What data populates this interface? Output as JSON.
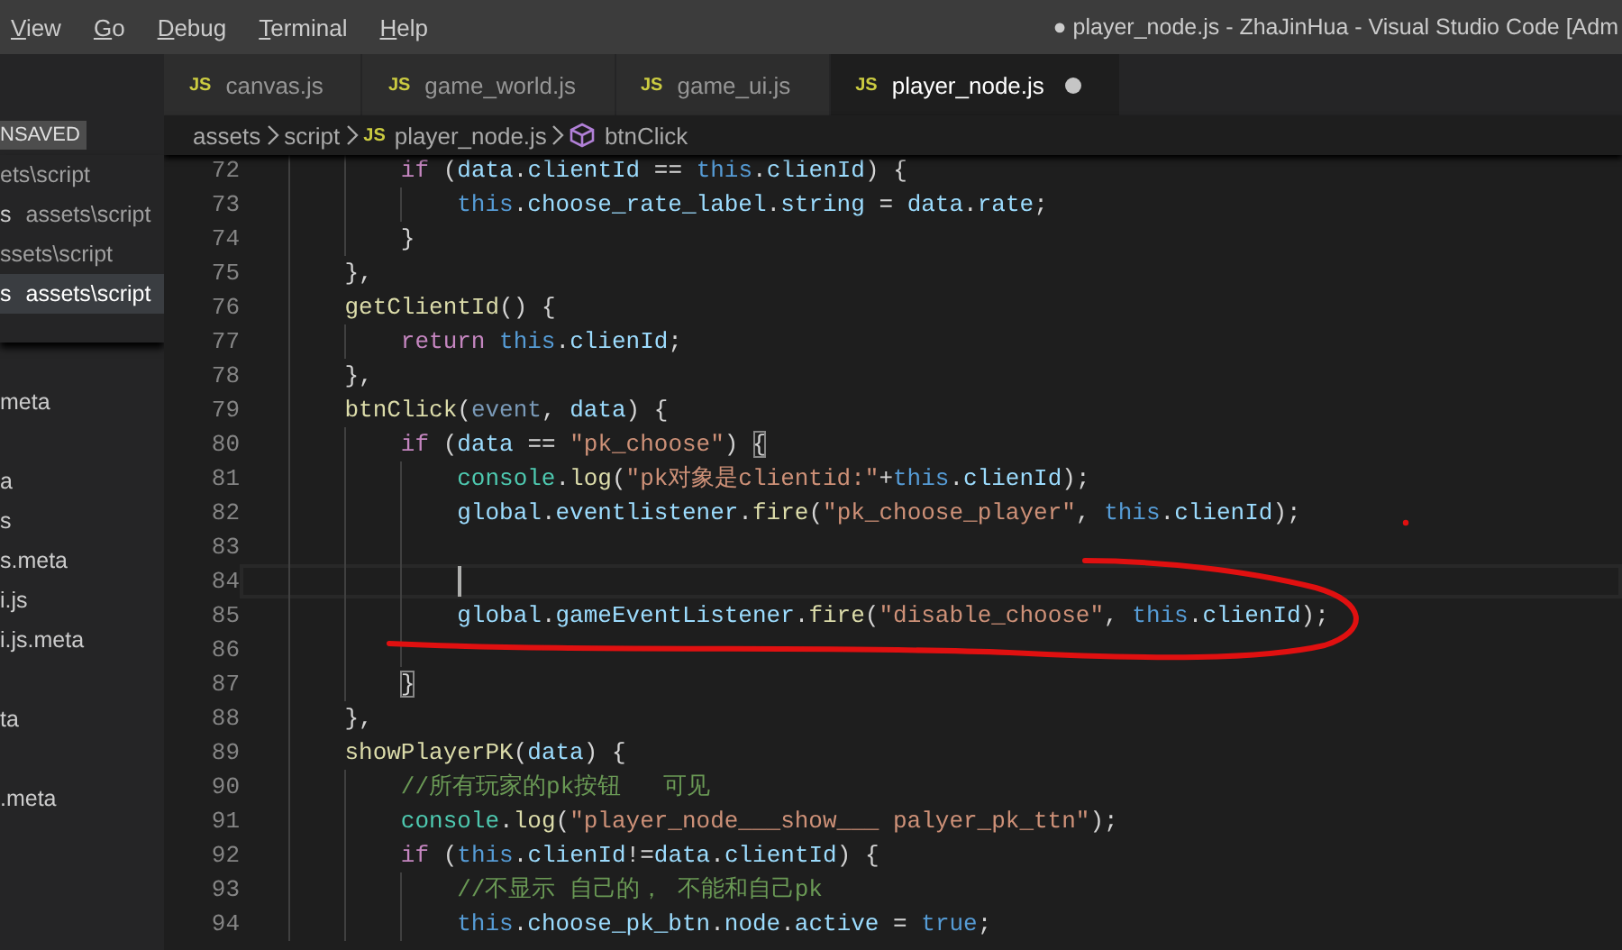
{
  "menu": {
    "items": [
      {
        "label": "View"
      },
      {
        "label": "Go"
      },
      {
        "label": "Debug"
      },
      {
        "label": "Terminal"
      },
      {
        "label": "Help"
      }
    ]
  },
  "window": {
    "title": "● player_node.js - ZhaJinHua - Visual Studio Code [Adm"
  },
  "sidebar": {
    "badge": "NSAVED",
    "open_editors": [
      {
        "path": "ets\\script",
        "selected": false
      },
      {
        "name": "s",
        "path": "assets\\script",
        "selected": false
      },
      {
        "path": "ssets\\script",
        "selected": false
      },
      {
        "name": "s",
        "path": "assets\\script",
        "selected": true
      }
    ],
    "explorer": [
      {
        "kind": "blank"
      },
      {
        "kind": "file",
        "label": "meta"
      },
      {
        "kind": "blank"
      },
      {
        "kind": "file",
        "label": "a"
      },
      {
        "kind": "file",
        "label": "s"
      },
      {
        "kind": "file",
        "label": "s.meta"
      },
      {
        "kind": "file",
        "label": "i.js"
      },
      {
        "kind": "file",
        "label": "i.js.meta"
      },
      {
        "kind": "blank"
      },
      {
        "kind": "file",
        "label": "ta"
      },
      {
        "kind": "blank"
      },
      {
        "kind": "file",
        "label": ".meta"
      }
    ]
  },
  "tabs": [
    {
      "icon_text": "JS",
      "label": "canvas.js",
      "selected": false,
      "dirty": false
    },
    {
      "icon_text": "JS",
      "label": "game_world.js",
      "selected": false,
      "dirty": false
    },
    {
      "icon_text": "JS",
      "label": "game_ui.js",
      "selected": false,
      "dirty": false
    },
    {
      "icon_text": "JS",
      "label": "player_node.js",
      "selected": true,
      "dirty": true
    }
  ],
  "breadcrumb": [
    {
      "kind": "folder",
      "text": "assets"
    },
    {
      "kind": "folder",
      "text": "script"
    },
    {
      "kind": "file",
      "icon_text": "JS",
      "text": "player_node.js"
    },
    {
      "kind": "symbol",
      "text": "btnClick"
    }
  ],
  "editor": {
    "lines": [
      {
        "number": "72",
        "current": false,
        "tokens": [
          {
            "kind": "kw",
            "text": "        if"
          },
          {
            "kind": "plain",
            "text": " ("
          },
          {
            "kind": "var",
            "text": "data"
          },
          {
            "kind": "plain",
            "text": "."
          },
          {
            "kind": "var",
            "text": "clientId"
          },
          {
            "kind": "plain",
            "text": " == "
          },
          {
            "kind": "this",
            "text": "this"
          },
          {
            "kind": "plain",
            "text": "."
          },
          {
            "kind": "var",
            "text": "clienId"
          },
          {
            "kind": "plain",
            "text": ") {"
          }
        ]
      },
      {
        "number": "73",
        "current": false,
        "tokens": [
          {
            "kind": "this",
            "text": "            this"
          },
          {
            "kind": "plain",
            "text": "."
          },
          {
            "kind": "var",
            "text": "choose_rate_label"
          },
          {
            "kind": "plain",
            "text": "."
          },
          {
            "kind": "var",
            "text": "string"
          },
          {
            "kind": "plain",
            "text": " = "
          },
          {
            "kind": "var",
            "text": "data"
          },
          {
            "kind": "plain",
            "text": "."
          },
          {
            "kind": "var",
            "text": "rate"
          },
          {
            "kind": "plain",
            "text": ";"
          }
        ]
      },
      {
        "number": "74",
        "current": false,
        "tokens": [
          {
            "kind": "plain",
            "text": "        }"
          }
        ]
      },
      {
        "number": "75",
        "current": false,
        "tokens": [
          {
            "kind": "plain",
            "text": "    },"
          }
        ]
      },
      {
        "number": "76",
        "current": false,
        "tokens": [
          {
            "kind": "fn",
            "text": "    getClientId"
          },
          {
            "kind": "plain",
            "text": "() {"
          }
        ]
      },
      {
        "number": "77",
        "current": false,
        "tokens": [
          {
            "kind": "kw",
            "text": "        return "
          },
          {
            "kind": "this",
            "text": "this"
          },
          {
            "kind": "plain",
            "text": "."
          },
          {
            "kind": "var",
            "text": "clienId"
          },
          {
            "kind": "plain",
            "text": ";"
          }
        ]
      },
      {
        "number": "78",
        "current": false,
        "tokens": [
          {
            "kind": "plain",
            "text": "    },"
          }
        ]
      },
      {
        "number": "79",
        "current": false,
        "tokens": [
          {
            "kind": "fn",
            "text": "    btnClick"
          },
          {
            "kind": "plain",
            "text": "("
          },
          {
            "kind": "unused",
            "text": "event"
          },
          {
            "kind": "plain",
            "text": ", "
          },
          {
            "kind": "var",
            "text": "data"
          },
          {
            "kind": "plain",
            "text": ") {"
          }
        ]
      },
      {
        "number": "80",
        "current": false,
        "tokens": [
          {
            "kind": "kw",
            "text": "        if"
          },
          {
            "kind": "plain",
            "text": " ("
          },
          {
            "kind": "var",
            "text": "data"
          },
          {
            "kind": "plain",
            "text": " == "
          },
          {
            "kind": "str",
            "text": "\"pk_choose\""
          },
          {
            "kind": "plain",
            "text": ") "
          },
          {
            "kind": "match",
            "text": "{"
          }
        ]
      },
      {
        "number": "81",
        "current": false,
        "tokens": [
          {
            "kind": "console",
            "text": "            console"
          },
          {
            "kind": "plain",
            "text": "."
          },
          {
            "kind": "fn",
            "text": "log"
          },
          {
            "kind": "plain",
            "text": "("
          },
          {
            "kind": "str",
            "text": "\"pk对象是clientid:\""
          },
          {
            "kind": "plain",
            "text": "+"
          },
          {
            "kind": "this",
            "text": "this"
          },
          {
            "kind": "plain",
            "text": "."
          },
          {
            "kind": "var",
            "text": "clienId"
          },
          {
            "kind": "plain",
            "text": ");"
          }
        ]
      },
      {
        "number": "82",
        "current": false,
        "tokens": [
          {
            "kind": "var",
            "text": "            global"
          },
          {
            "kind": "plain",
            "text": "."
          },
          {
            "kind": "var",
            "text": "eventlistener"
          },
          {
            "kind": "plain",
            "text": "."
          },
          {
            "kind": "fn",
            "text": "fire"
          },
          {
            "kind": "plain",
            "text": "("
          },
          {
            "kind": "str",
            "text": "\"pk_choose_player\""
          },
          {
            "kind": "plain",
            "text": ", "
          },
          {
            "kind": "this",
            "text": "this"
          },
          {
            "kind": "plain",
            "text": "."
          },
          {
            "kind": "var",
            "text": "clienId"
          },
          {
            "kind": "plain",
            "text": ");"
          }
        ]
      },
      {
        "number": "83",
        "current": false
      },
      {
        "number": "84",
        "current": true
      },
      {
        "number": "85",
        "current": false,
        "tokens": [
          {
            "kind": "var",
            "text": "            global"
          },
          {
            "kind": "plain",
            "text": "."
          },
          {
            "kind": "var",
            "text": "gameEventListener"
          },
          {
            "kind": "plain",
            "text": "."
          },
          {
            "kind": "fn",
            "text": "fire"
          },
          {
            "kind": "plain",
            "text": "("
          },
          {
            "kind": "str",
            "text": "\"disable_choose\""
          },
          {
            "kind": "plain",
            "text": ", "
          },
          {
            "kind": "this",
            "text": "this"
          },
          {
            "kind": "plain",
            "text": "."
          },
          {
            "kind": "var",
            "text": "clienId"
          },
          {
            "kind": "plain",
            "text": ");"
          }
        ]
      },
      {
        "number": "86",
        "current": false
      },
      {
        "number": "87",
        "current": false,
        "tokens": [
          {
            "kind": "match",
            "text": "        }"
          }
        ]
      },
      {
        "number": "88",
        "current": false,
        "tokens": [
          {
            "kind": "plain",
            "text": "    },"
          }
        ]
      },
      {
        "number": "89",
        "current": false,
        "tokens": [
          {
            "kind": "fn",
            "text": "    showPlayerPK"
          },
          {
            "kind": "plain",
            "text": "("
          },
          {
            "kind": "var",
            "text": "data"
          },
          {
            "kind": "plain",
            "text": ") {"
          }
        ]
      },
      {
        "number": "90",
        "current": false,
        "tokens": [
          {
            "kind": "cmt",
            "text": "        //所有玩家的pk按钮   可见"
          }
        ]
      },
      {
        "number": "91",
        "current": false,
        "tokens": [
          {
            "kind": "console",
            "text": "        console"
          },
          {
            "kind": "plain",
            "text": "."
          },
          {
            "kind": "fn",
            "text": "log"
          },
          {
            "kind": "plain",
            "text": "("
          },
          {
            "kind": "str",
            "text": "\"player_node___show___ palyer_pk_ttn\""
          },
          {
            "kind": "plain",
            "text": ");"
          }
        ]
      },
      {
        "number": "92",
        "current": false,
        "tokens": [
          {
            "kind": "kw",
            "text": "        if"
          },
          {
            "kind": "plain",
            "text": " ("
          },
          {
            "kind": "this",
            "text": "this"
          },
          {
            "kind": "plain",
            "text": "."
          },
          {
            "kind": "var",
            "text": "clienId"
          },
          {
            "kind": "plain",
            "text": "!="
          },
          {
            "kind": "var",
            "text": "data"
          },
          {
            "kind": "plain",
            "text": "."
          },
          {
            "kind": "var",
            "text": "clientId"
          },
          {
            "kind": "plain",
            "text": ") {"
          }
        ]
      },
      {
        "number": "93",
        "current": false,
        "tokens": [
          {
            "kind": "cmt",
            "text": "            //不显示 自己的， 不能和自己pk"
          }
        ]
      },
      {
        "number": "94",
        "current": false,
        "tokens": [
          {
            "kind": "this",
            "text": "            this"
          },
          {
            "kind": "plain",
            "text": "."
          },
          {
            "kind": "var",
            "text": "choose_pk_btn"
          },
          {
            "kind": "plain",
            "text": "."
          },
          {
            "kind": "var",
            "text": "node"
          },
          {
            "kind": "plain",
            "text": "."
          },
          {
            "kind": "var",
            "text": "active"
          },
          {
            "kind": "plain",
            "text": " = "
          },
          {
            "kind": "this",
            "text": "true"
          },
          {
            "kind": "plain",
            "text": ";"
          }
        ]
      }
    ]
  }
}
